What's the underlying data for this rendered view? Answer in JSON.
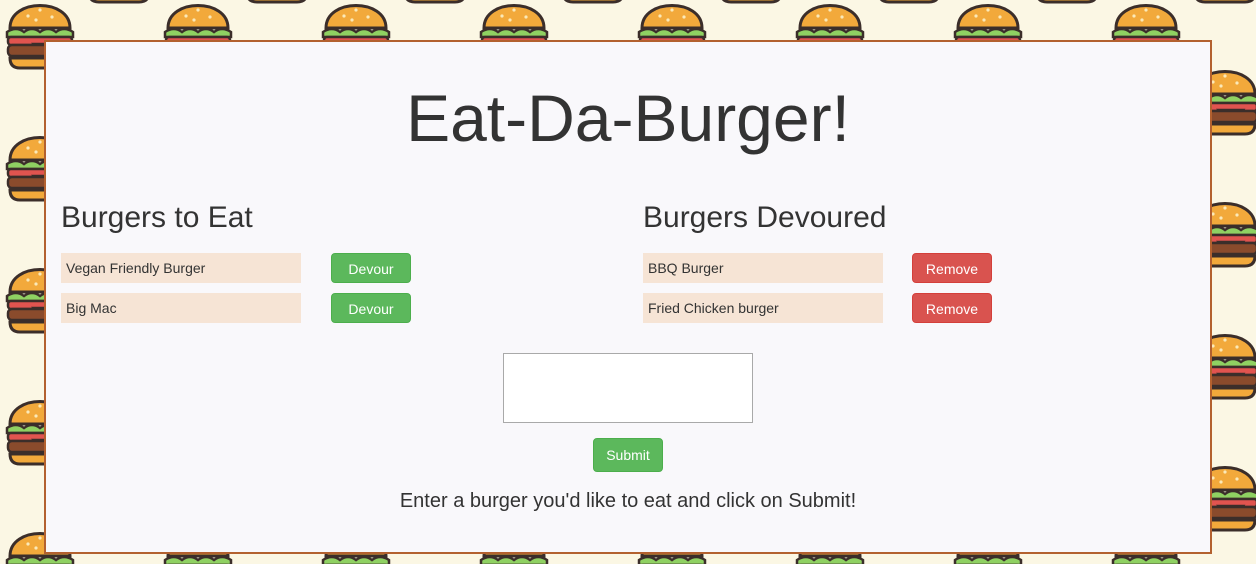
{
  "page": {
    "title": "Eat-Da-Burger!",
    "instructions": "Enter a burger you'd like to eat and click on Submit!"
  },
  "to_eat": {
    "heading": "Burgers to Eat",
    "items": [
      {
        "name": "Vegan Friendly Burger",
        "action": "Devour"
      },
      {
        "name": "Big Mac",
        "action": "Devour"
      }
    ]
  },
  "devoured": {
    "heading": "Burgers Devoured",
    "items": [
      {
        "name": "BBQ Burger",
        "action": "Remove"
      },
      {
        "name": "Fried Chicken burger",
        "action": "Remove"
      }
    ]
  },
  "form": {
    "input_value": "",
    "submit_label": "Submit"
  },
  "colors": {
    "panel_border": "#b3612f",
    "panel_bg": "#f9f8fb",
    "item_bg": "#f6e4d5",
    "devour_button": "#5cb85c",
    "remove_button": "#d9534f",
    "pattern_bg": "#fbf7e4"
  },
  "background": {
    "pattern": "burger-pattern"
  }
}
